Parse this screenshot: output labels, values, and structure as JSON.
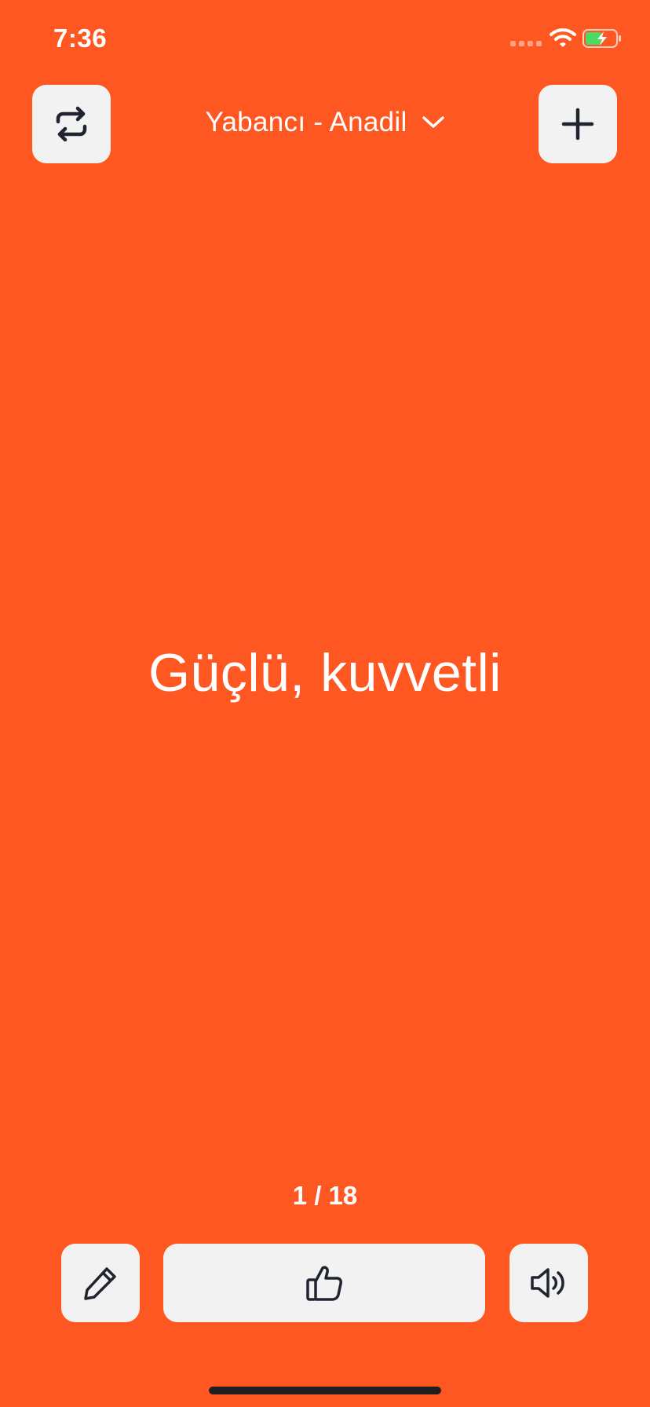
{
  "status_bar": {
    "time": "7:36"
  },
  "header": {
    "mode_label": "Yabancı - Anadil",
    "left_icon": "swap-arrows-icon",
    "right_icon": "plus-icon",
    "dropdown_icon": "chevron-down-icon"
  },
  "card": {
    "word": "Güçlü, kuvvetli"
  },
  "pagination": {
    "counter": "1 / 18",
    "current": 1,
    "total": 18
  },
  "footer": {
    "edit_icon": "pencil-icon",
    "like_icon": "thumbs-up-icon",
    "sound_icon": "speaker-icon"
  },
  "colors": {
    "background": "#FF5722",
    "button_bg": "#F2F2F2",
    "icon": "#1F2430",
    "text": "#FFFFFF",
    "battery_fill": "#4CD964"
  }
}
